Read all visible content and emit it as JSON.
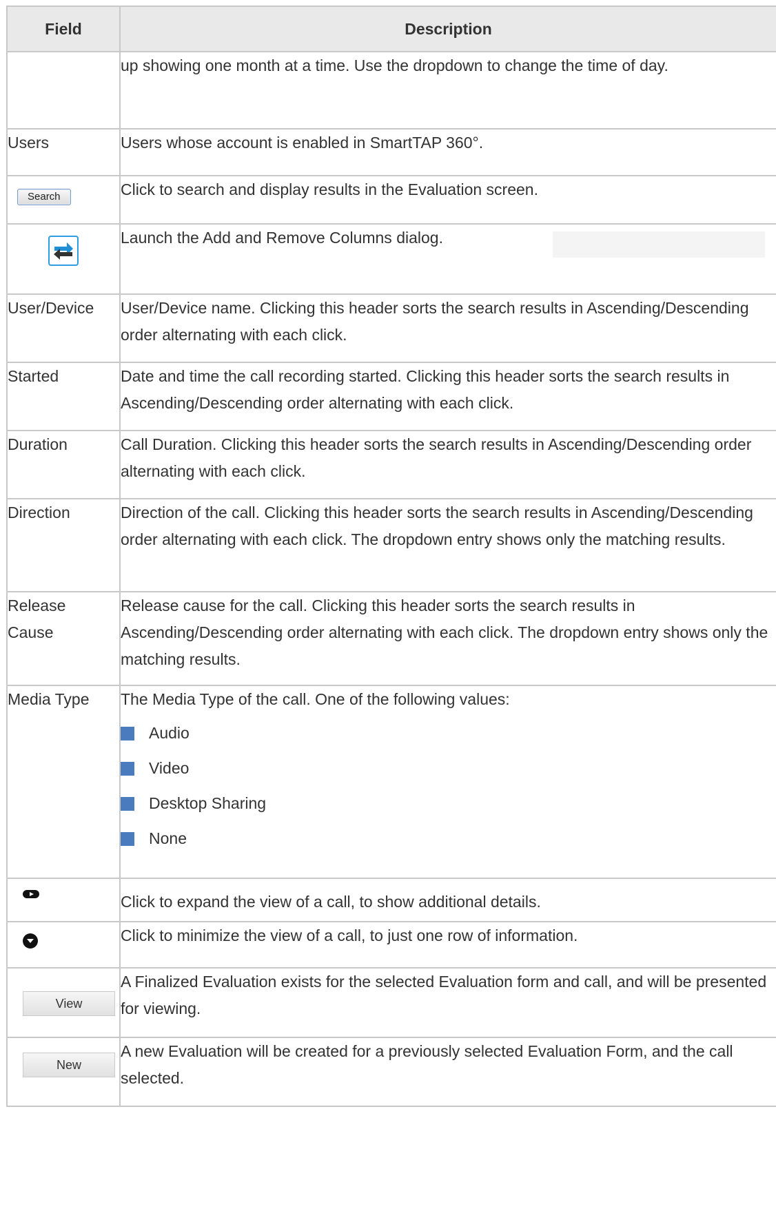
{
  "table": {
    "headers": {
      "field": "Field",
      "description": "Description"
    },
    "rows": [
      {
        "field": "",
        "description": "up showing one month at a time. Use the dropdown to change the time of day."
      },
      {
        "field": "Users",
        "description": "Users whose account is enabled in SmartTAP 360°."
      },
      {
        "field_button": "Search",
        "description": "Click to search and display results in the Evaluation screen."
      },
      {
        "field_icon": "swap-columns-icon",
        "description": "Launch the Add and Remove Columns dialog."
      },
      {
        "field": "User/Device",
        "description": "User/Device name. Clicking this header sorts the search results in Ascending/Descending order alternating with each click."
      },
      {
        "field": "Started",
        "description": "Date and time the call recording started. Clicking this header sorts the search results in Ascending/Descending order alternating with each click."
      },
      {
        "field": "Duration",
        "description": "Call Duration. Clicking this header sorts the search results in Ascending/Descending order alternating with each click."
      },
      {
        "field": "Direction",
        "description": "Direction of the call. Clicking this header sorts the search results in Ascending/Descending order alternating with each click. The dropdown entry shows only the matching results."
      },
      {
        "field": "Release Cause",
        "description": "Release cause for the call. Clicking this header sorts the search results in Ascending/Descending order alternating with each click. The dropdown entry shows only the matching results."
      },
      {
        "field": "Media Type",
        "description": "The Media Type of the call. One of the following values:",
        "values": [
          "Audio",
          "Video",
          "Desktop Sharing",
          "None"
        ]
      },
      {
        "field_icon": "expand-icon",
        "description": "Click to expand the view of a call, to show additional details."
      },
      {
        "field_icon": "collapse-icon",
        "description": "Click to minimize the view of a call, to just one row of information."
      },
      {
        "field_button": "View",
        "description": "A Finalized Evaluation exists for the selected Evaluation form and call, and will be presented for viewing."
      },
      {
        "field_button": "New",
        "description": "A new Evaluation will be created for a previously selected Evaluation Form, and the call selected."
      }
    ]
  },
  "colors": {
    "header_bg": "#e9e9e9",
    "border": "#c8c8c8",
    "bullet": "#4a7bbf",
    "icon_accent": "#2b9de0"
  }
}
